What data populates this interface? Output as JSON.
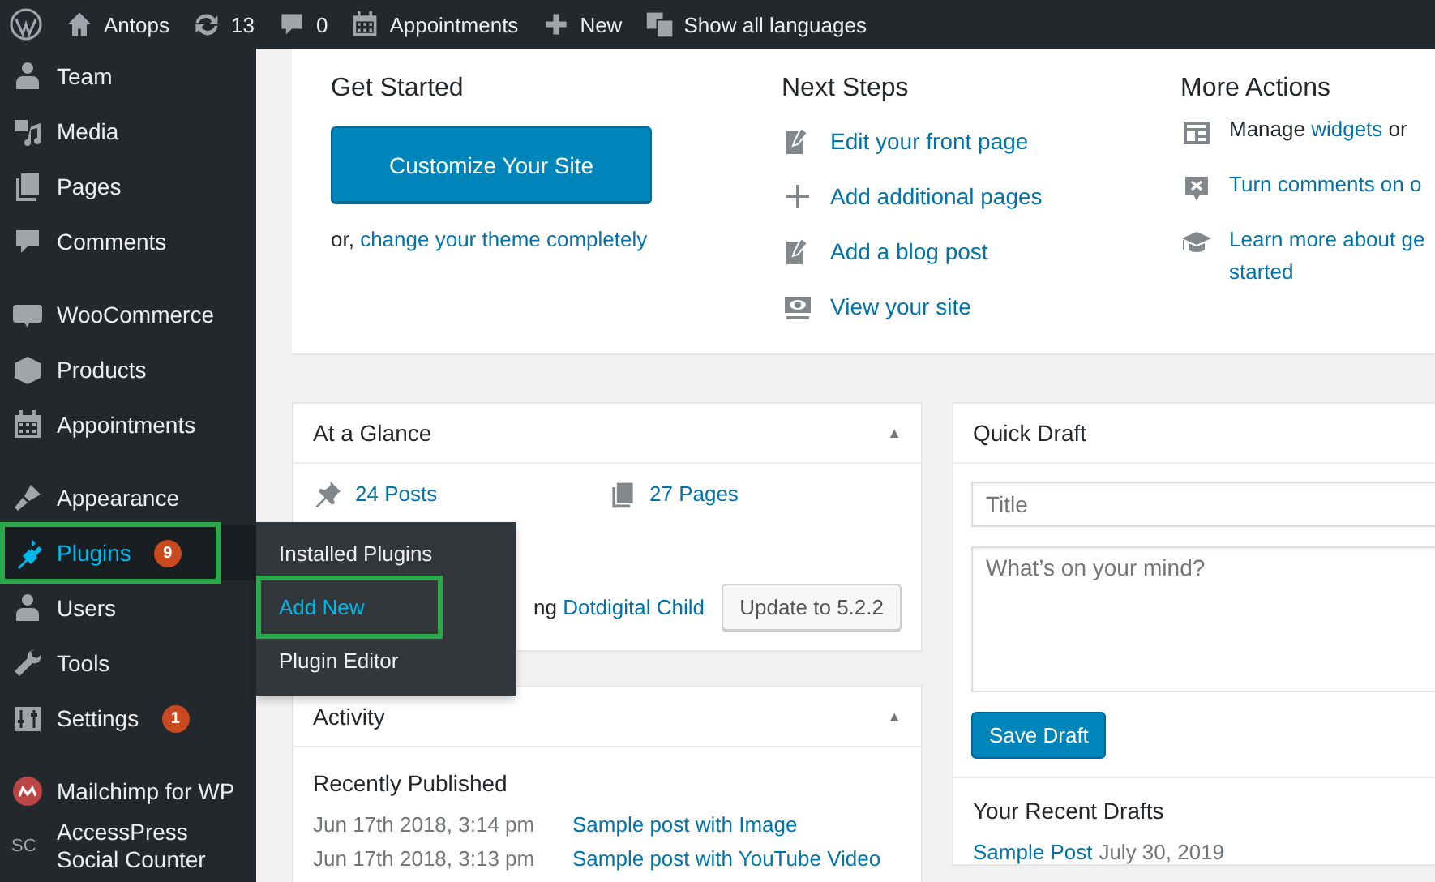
{
  "admin_bar": [
    {
      "kind": "logo"
    },
    {
      "kind": "home",
      "label": "Antops"
    },
    {
      "kind": "updates",
      "label": "13"
    },
    {
      "kind": "comments",
      "label": "0"
    },
    {
      "kind": "calendar",
      "label": "Appointments"
    },
    {
      "kind": "new",
      "label": "New"
    },
    {
      "kind": "languages",
      "label": "Show all languages"
    }
  ],
  "sidebar": {
    "groups": [
      {
        "items": [
          {
            "label": "Team",
            "selected": false,
            "highlighted": false
          },
          {
            "label": "Media",
            "selected": false,
            "highlighted": false
          },
          {
            "label": "Pages",
            "selected": false,
            "highlighted": false
          },
          {
            "label": "Comments",
            "selected": false,
            "highlighted": false
          }
        ]
      },
      {
        "items": [
          {
            "label": "WooCommerce",
            "selected": false,
            "highlighted": false
          },
          {
            "label": "Products",
            "selected": false,
            "highlighted": false
          },
          {
            "label": "Appointments",
            "selected": false,
            "highlighted": false
          }
        ]
      },
      {
        "items": [
          {
            "label": "Appearance",
            "selected": false,
            "highlighted": false
          },
          {
            "label": "Plugins",
            "badge": "9",
            "selected": true,
            "highlighted": true,
            "submenu": [
              {
                "label": "Installed Plugins",
                "selected": false,
                "highlighted": false
              },
              {
                "label": "Add New",
                "selected": true,
                "highlighted": true
              },
              {
                "label": "Plugin Editor",
                "selected": false,
                "highlighted": false
              }
            ]
          },
          {
            "label": "Users",
            "selected": false,
            "highlighted": false
          },
          {
            "label": "Tools",
            "selected": false,
            "highlighted": false
          },
          {
            "label": "Settings",
            "badge": "1",
            "selected": false,
            "highlighted": false
          }
        ]
      },
      {
        "items": [
          {
            "label": "Mailchimp for WP",
            "selected": false,
            "highlighted": false
          },
          {
            "label": "AccessPress Social Counter",
            "icon_text": "SC",
            "selected": false,
            "highlighted": false
          }
        ]
      }
    ]
  },
  "welcome": {
    "get_started": {
      "title": "Get Started",
      "button": "Customize Your Site",
      "prefix": "or,",
      "link": "change your theme completely"
    },
    "next_steps": {
      "title": "Next Steps",
      "items": [
        "Edit your front page",
        "Add additional pages",
        "Add a blog post",
        "View your site"
      ]
    },
    "more_actions": {
      "title": "More Actions",
      "items": [
        {
          "text": "Manage",
          "link": "widgets",
          "suffix": "or"
        },
        {
          "link": "Turn comments on o"
        },
        {
          "link": "Learn more about ge\nstarted"
        }
      ]
    }
  },
  "at_a_glance": {
    "title": "At a Glance",
    "toggle": "▲",
    "posts": "24 Posts",
    "pages": "27 Pages",
    "theme_prefix": "ng",
    "theme_link": "Dotdigital Child",
    "update_button": "Update to 5.2.2"
  },
  "activity": {
    "title": "Activity",
    "toggle": "▲",
    "section": "Recently Published",
    "rows": [
      {
        "date": "Jun 17th 2018, 3:14 pm",
        "link": "Sample post with Image"
      },
      {
        "date": "Jun 17th 2018, 3:13 pm",
        "link": "Sample post with YouTube Video"
      }
    ]
  },
  "quick_draft": {
    "title": "Quick Draft",
    "title_placeholder": "Title",
    "content_placeholder": "What’s on your mind?",
    "button": "Save Draft",
    "recent_title": "Your Recent Drafts",
    "recent": [
      {
        "link": "Sample Post",
        "date": "July 30, 2019"
      }
    ]
  }
}
